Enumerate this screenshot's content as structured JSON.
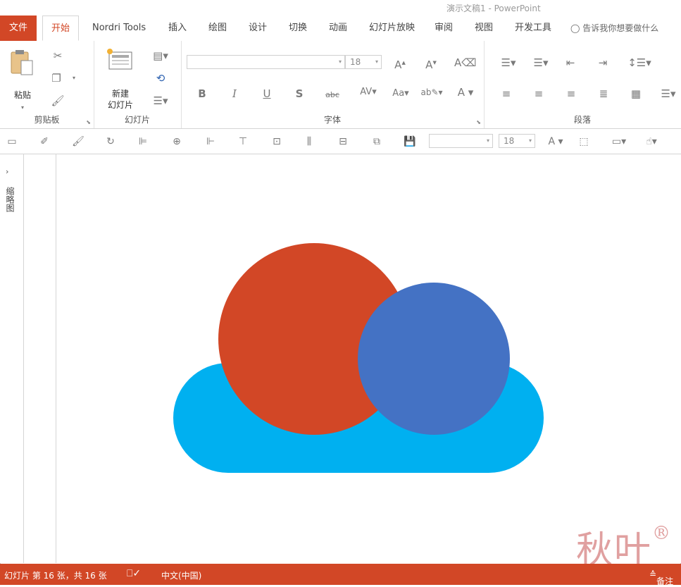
{
  "window": {
    "title": "演示文稿1  -  PowerPoint"
  },
  "tabs": [
    {
      "label": "文件",
      "kind": "file"
    },
    {
      "label": "开始",
      "kind": "active"
    },
    {
      "label": "Nordri Tools"
    },
    {
      "label": "插入"
    },
    {
      "label": "绘图"
    },
    {
      "label": "设计"
    },
    {
      "label": "切换"
    },
    {
      "label": "动画"
    },
    {
      "label": "幻灯片放映"
    },
    {
      "label": "审阅"
    },
    {
      "label": "视图"
    },
    {
      "label": "开发工具"
    }
  ],
  "tell_me": {
    "label": "告诉我你想要做什么"
  },
  "ribbon": {
    "clipboard": {
      "label": "剪贴板",
      "paste_label": "粘贴"
    },
    "slides": {
      "label": "幻灯片",
      "new_slide_line1": "新建",
      "new_slide_line2": "幻灯片"
    },
    "font": {
      "label": "字体",
      "font_size": "18"
    },
    "paragraph": {
      "label": "段落"
    }
  },
  "qat": {
    "font_size": "18"
  },
  "thumbnails_pane": {
    "label": "缩略图"
  },
  "slide": {
    "shapes": [
      {
        "name": "cloud-base",
        "color": "#00b0f0"
      },
      {
        "name": "red-circle",
        "color": "#d24726"
      },
      {
        "name": "blue-circle",
        "color": "#4472c4"
      }
    ]
  },
  "watermark": {
    "text": "秋叶",
    "mark": "®"
  },
  "status": {
    "slide_info": "幻灯片 第 16 张，共 16 张",
    "language": "中文(中国)",
    "notes": "备注"
  },
  "colors": {
    "accent": "#d24726",
    "cloud": "#00b0f0",
    "circle_red": "#d24726",
    "circle_blue": "#4472c4"
  }
}
